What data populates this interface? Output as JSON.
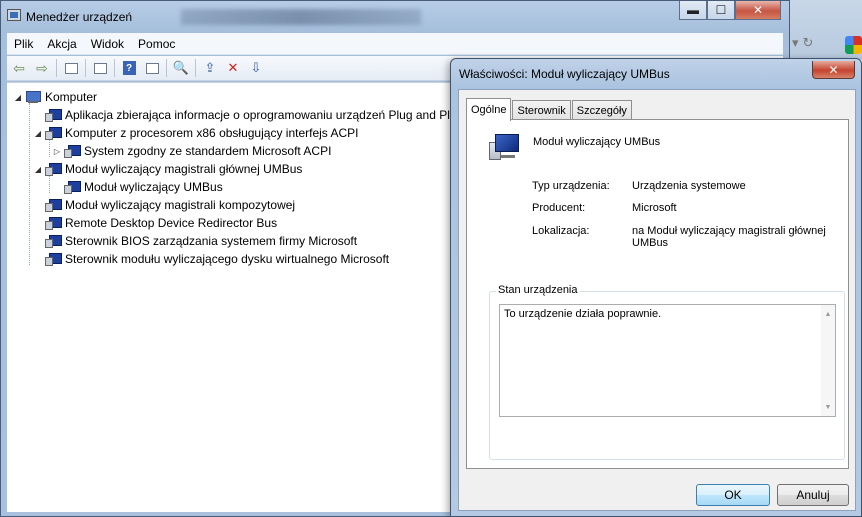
{
  "main_window": {
    "title": "Menedżer urządzeń",
    "menu": [
      "Plik",
      "Akcja",
      "Widok",
      "Pomoc"
    ],
    "window_buttons": {
      "minimize": "▬",
      "maximize": "☐",
      "close": "✕"
    }
  },
  "toolbar": {
    "icons": [
      "back-arrow-icon",
      "forward-arrow-icon",
      "show-hide-console-tree-icon",
      "properties-view-icon",
      "help-icon",
      "action-pane-icon",
      "scan-hardware-icon",
      "update-driver-icon",
      "uninstall-icon",
      "disable-device-icon"
    ]
  },
  "tree": {
    "root": "Komputer",
    "nodes": [
      {
        "label": "Aplikacja zbierająca informacje o oprogramowaniu urządzeń Plug and Pl",
        "level": 1,
        "expander": ""
      },
      {
        "label": "Komputer z procesorem x86 obsługujący interfejs ACPI",
        "level": 1,
        "expander": "◢"
      },
      {
        "label": "System zgodny ze standardem Microsoft ACPI",
        "level": 2,
        "expander": "▷"
      },
      {
        "label": "Moduł wyliczający magistrali głównej UMBus",
        "level": 1,
        "expander": "◢"
      },
      {
        "label": "Moduł wyliczający UMBus",
        "level": 2,
        "expander": ""
      },
      {
        "label": "Moduł wyliczający magistrali kompozytowej",
        "level": 1,
        "expander": ""
      },
      {
        "label": "Remote Desktop Device Redirector Bus",
        "level": 1,
        "expander": ""
      },
      {
        "label": "Sterownik BIOS zarządzania systemem firmy Microsoft",
        "level": 1,
        "expander": ""
      },
      {
        "label": "Sterownik modułu wyliczającego dysku wirtualnego Microsoft",
        "level": 1,
        "expander": ""
      }
    ]
  },
  "dialog": {
    "title": "Właściwości: Moduł wyliczający UMBus",
    "close_label": "✕",
    "tabs": [
      "Ogólne",
      "Sterownik",
      "Szczegóły"
    ],
    "active_tab": "Ogólne",
    "device_name": "Moduł wyliczający UMBus",
    "properties": [
      {
        "label": "Typ urządzenia:",
        "value": "Urządzenia systemowe"
      },
      {
        "label": "Producent:",
        "value": "Microsoft"
      },
      {
        "label": "Lokalizacja:",
        "value": "na Moduł wyliczający magistrali głównej UMBus"
      }
    ],
    "status_group_label": "Stan urządzenia",
    "status_text": "To urządzenie działa poprawnie.",
    "ok_label": "OK",
    "cancel_label": "Anuluj"
  }
}
